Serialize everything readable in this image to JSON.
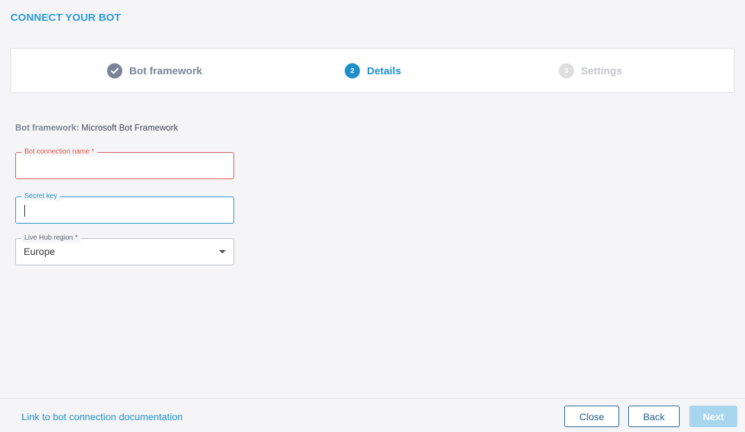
{
  "header": {
    "title": "CONNECT YOUR BOT"
  },
  "stepper": {
    "steps": [
      {
        "number": "",
        "label": "Bot framework",
        "state": "completed"
      },
      {
        "number": "2",
        "label": "Details",
        "state": "active"
      },
      {
        "number": "3",
        "label": "Settings",
        "state": "pending"
      }
    ]
  },
  "form": {
    "framework_label": "Bot framework:",
    "framework_value": "Microsoft Bot Framework",
    "connection_name": {
      "label": "Bot connection name *",
      "value": ""
    },
    "secret_key": {
      "label": "Secret key",
      "value": ""
    },
    "region": {
      "label": "Live Hub region *",
      "value": "Europe"
    }
  },
  "footer": {
    "doc_link": "Link to bot connection documentation",
    "close_label": "Close",
    "back_label": "Back",
    "next_label": "Next"
  },
  "colors": {
    "accent": "#1f8fcc",
    "error": "#d9534f",
    "completed": "#7a8499",
    "disabled_next": "#a8d6ee"
  }
}
